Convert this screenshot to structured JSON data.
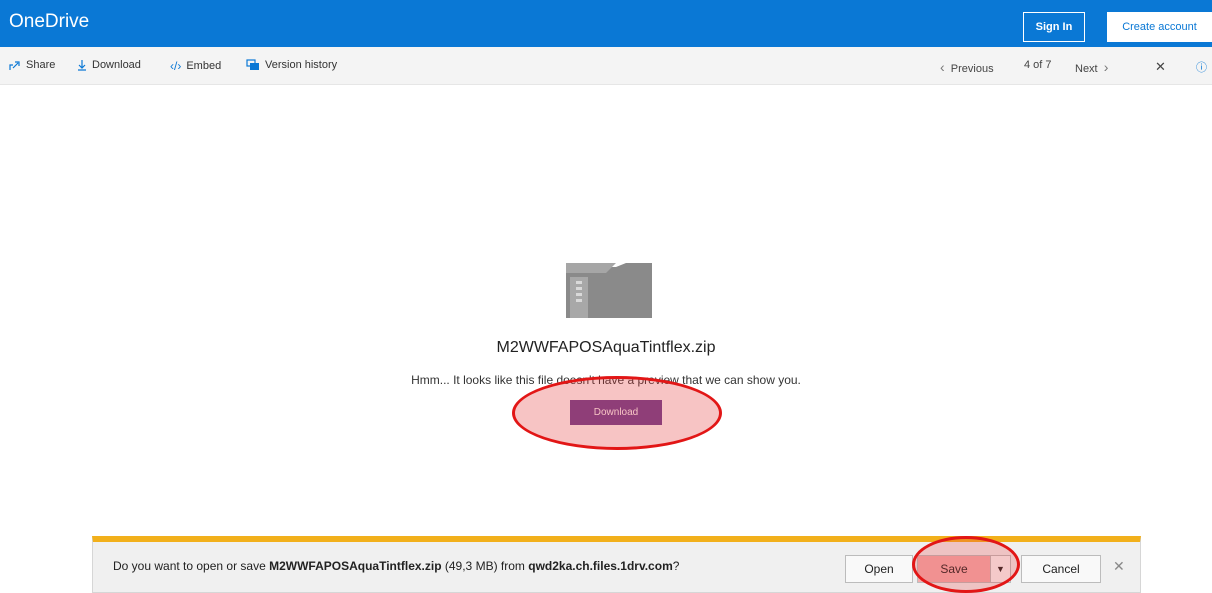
{
  "header": {
    "brand": "OneDrive",
    "sign_in": "Sign In",
    "create_account": "Create account"
  },
  "commandbar": {
    "share": "Share",
    "download": "Download",
    "embed": "Embed",
    "version_history": "Version history",
    "previous": "Previous",
    "position": "4 of 7",
    "next": "Next"
  },
  "preview": {
    "filename": "M2WWFAPOSAquaTintflex.zip",
    "message": "Hmm... It looks like this file doesn't have a preview that we can show you.",
    "download_button": "Download"
  },
  "notification": {
    "prefix": "Do you want to open or save ",
    "filename": "M2WWFAPOSAquaTintflex.zip",
    "size": " (49,3 MB) from ",
    "host": "qwd2ka.ch.files.1drv.com",
    "suffix": "?",
    "open": "Open",
    "save": "Save",
    "cancel": "Cancel"
  },
  "icons": {
    "share": "share-icon",
    "download": "download-icon",
    "embed": "embed-icon",
    "version_history": "version-history-icon",
    "close": "close-icon",
    "info": "info-icon",
    "file": "zip-file-icon"
  },
  "colors": {
    "brand_blue": "#0a78d5",
    "download_purple": "#6b3f93",
    "notification_accent": "#f2b01b",
    "highlight_red": "#e21616"
  }
}
